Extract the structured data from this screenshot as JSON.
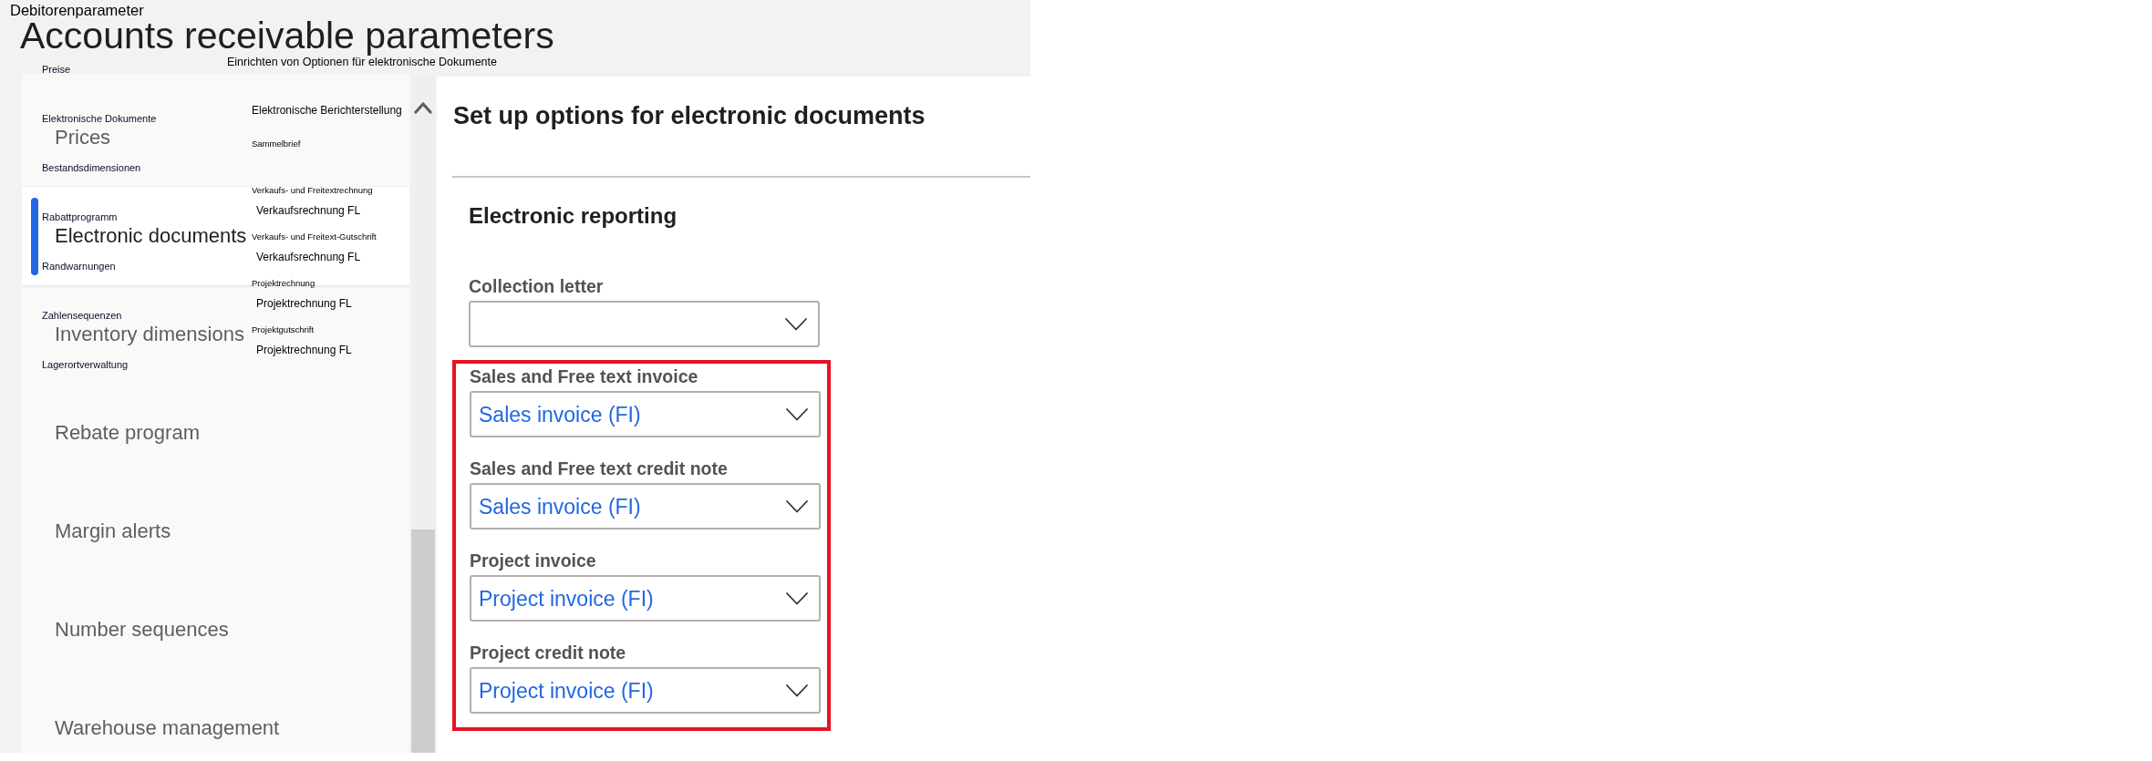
{
  "page_title": "Accounts receivable parameters",
  "overlay": {
    "title": "Debitorenparameter",
    "subtitle": "Einrichten von Optionen für elektronische Dokumente",
    "nav_labels": [
      "Preise",
      "Elektronische Dokumente",
      "Bestandsdimensionen",
      "Rabattprogramm",
      "Randwarnungen",
      "Zahlensequenzen",
      "Lagerortverwaltung"
    ],
    "section_title": "Elektronische Berichterstellung",
    "fields": [
      {
        "label": "Sammelbrief"
      },
      {
        "label": "Verkaufs- und Freitextrechnung",
        "value": "Verkaufsrechnung FL"
      },
      {
        "label": "Verkaufs- und Freitext-Gutschrift",
        "value": "Verkaufsrechnung FL"
      },
      {
        "label": "Projektrechnung",
        "value": "Projektrechnung FL"
      },
      {
        "label": "Projektgutschrift",
        "value": "Projektrechnung FL"
      }
    ]
  },
  "nav": {
    "items": [
      {
        "label": "Prices",
        "selected": false
      },
      {
        "label": "Electronic documents",
        "selected": true
      },
      {
        "label": "Inventory dimensions",
        "selected": false
      },
      {
        "label": "Rebate program",
        "selected": false
      },
      {
        "label": "Margin alerts",
        "selected": false
      },
      {
        "label": "Number sequences",
        "selected": false
      },
      {
        "label": "Warehouse management",
        "selected": false
      }
    ]
  },
  "content": {
    "title": "Set up options for electronic documents",
    "section": {
      "title": "Electronic reporting",
      "fields": [
        {
          "label": "Collection letter",
          "highlighted": false
        },
        {
          "label": "Sales and Free text invoice",
          "value": "Sales invoice (FI)",
          "highlighted": true
        },
        {
          "label": "Sales and Free text credit note",
          "value": "Sales invoice (FI)",
          "highlighted": true
        },
        {
          "label": "Project invoice",
          "value": "Project invoice (FI)",
          "highlighted": true
        },
        {
          "label": "Project credit note",
          "value": "Project invoice (FI)",
          "highlighted": true
        }
      ]
    }
  }
}
